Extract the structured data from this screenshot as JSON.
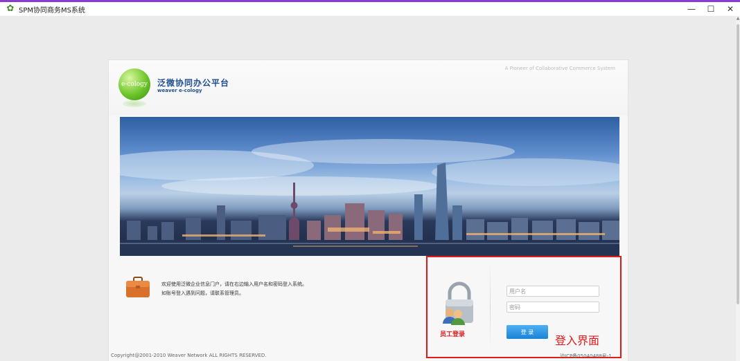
{
  "window": {
    "title": "SPM协同商务MS系统",
    "icon": "gear-icon",
    "controls": {
      "minimize": "—",
      "maximize": "☐",
      "close": "✕"
    }
  },
  "header": {
    "slogan": "A Pioneer of Collaborative Commerce System",
    "logo_text": "e-cology",
    "brand_cn": "泛微协同办公平台",
    "brand_en": "weaver e-cology"
  },
  "welcome": {
    "line1": "欢迎使用泛微企业信息门户，请在右边输入用户名和密码登入系统。",
    "line2": "如账号登入遇到问题，请联系管理员。"
  },
  "login": {
    "section_label": "员工登录",
    "username_placeholder": "用户名",
    "password_placeholder": "密码",
    "submit_label": "登 录",
    "annotation": "登入界面"
  },
  "footer": {
    "copyright": "Copyright@2001-2010 Weaver Network ALL RIGHTS RESERVED.",
    "icp": "沪ICP备05040488号-1"
  },
  "colors": {
    "annotation_red": "#e21a1a",
    "brand_blue": "#1f4f8f",
    "login_button": "#1a82d6",
    "logo_green": "#6ec62b"
  }
}
